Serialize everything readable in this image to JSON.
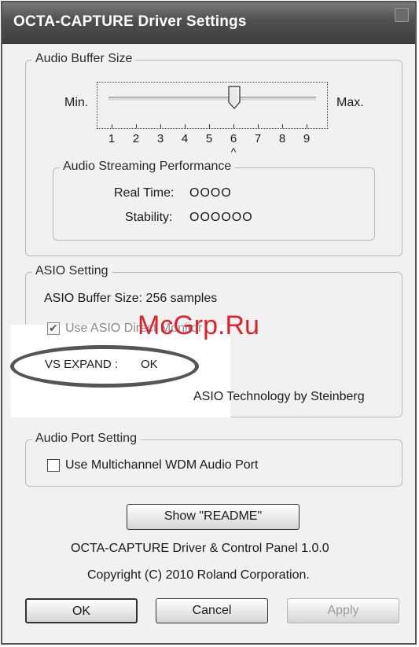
{
  "window": {
    "title": "OCTA-CAPTURE Driver Settings"
  },
  "audio_buffer": {
    "legend": "Audio Buffer Size",
    "min_label": "Min.",
    "max_label": "Max.",
    "ticks": [
      "1",
      "2",
      "3",
      "4",
      "5",
      "6",
      "7",
      "8",
      "9"
    ],
    "selected_value": 6,
    "caret": "^"
  },
  "streaming": {
    "legend": "Audio Streaming Performance",
    "realtime_label": "Real Time:",
    "realtime_value": "OOOO",
    "stability_label": "Stability:",
    "stability_value": "OOOOOO"
  },
  "asio": {
    "legend": "ASIO Setting",
    "buffer_size": "ASIO Buffer Size:  256 samples",
    "direct_monitor_label": "Use ASIO Direct Monitor",
    "direct_monitor_checked": true,
    "vs_expand": "VS EXPAND :",
    "vs_expand_value": "OK",
    "tech_credit": "ASIO Technology by Steinberg"
  },
  "audio_port": {
    "legend": "Audio Port Setting",
    "wdm_label": "Use Multichannel WDM Audio Port",
    "wdm_checked": false
  },
  "readme_button": "Show \"README\"",
  "version_text": "OCTA-CAPTURE Driver & Control Panel 1.0.0",
  "copyright_text": "Copyright (C) 2010 Roland Corporation.",
  "buttons": {
    "ok": "OK",
    "cancel": "Cancel",
    "apply": "Apply"
  },
  "watermark": "McGrp.Ru",
  "colors": {
    "watermark": "#e0212b",
    "titlebar": "#4f4f4f"
  }
}
